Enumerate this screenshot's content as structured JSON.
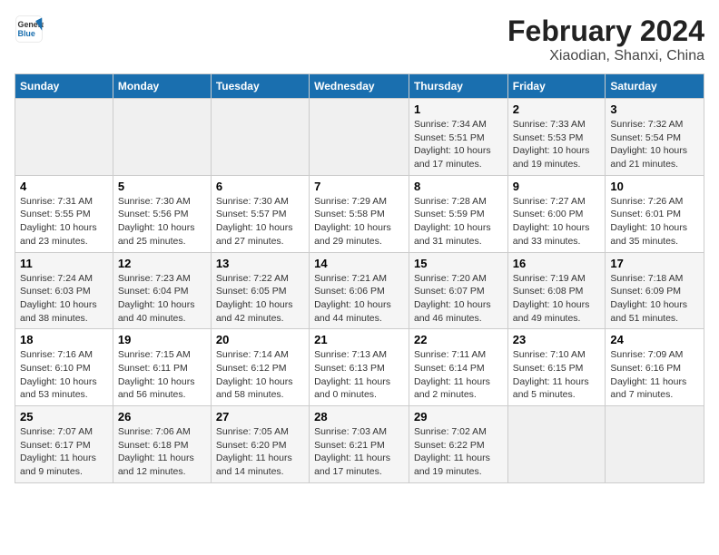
{
  "header": {
    "logo_line1": "General",
    "logo_line2": "Blue",
    "title": "February 2024",
    "subtitle": "Xiaodian, Shanxi, China"
  },
  "weekdays": [
    "Sunday",
    "Monday",
    "Tuesday",
    "Wednesday",
    "Thursday",
    "Friday",
    "Saturday"
  ],
  "weeks": [
    [
      {
        "day": "",
        "info": ""
      },
      {
        "day": "",
        "info": ""
      },
      {
        "day": "",
        "info": ""
      },
      {
        "day": "",
        "info": ""
      },
      {
        "day": "1",
        "info": "Sunrise: 7:34 AM\nSunset: 5:51 PM\nDaylight: 10 hours and 17 minutes."
      },
      {
        "day": "2",
        "info": "Sunrise: 7:33 AM\nSunset: 5:53 PM\nDaylight: 10 hours and 19 minutes."
      },
      {
        "day": "3",
        "info": "Sunrise: 7:32 AM\nSunset: 5:54 PM\nDaylight: 10 hours and 21 minutes."
      }
    ],
    [
      {
        "day": "4",
        "info": "Sunrise: 7:31 AM\nSunset: 5:55 PM\nDaylight: 10 hours and 23 minutes."
      },
      {
        "day": "5",
        "info": "Sunrise: 7:30 AM\nSunset: 5:56 PM\nDaylight: 10 hours and 25 minutes."
      },
      {
        "day": "6",
        "info": "Sunrise: 7:30 AM\nSunset: 5:57 PM\nDaylight: 10 hours and 27 minutes."
      },
      {
        "day": "7",
        "info": "Sunrise: 7:29 AM\nSunset: 5:58 PM\nDaylight: 10 hours and 29 minutes."
      },
      {
        "day": "8",
        "info": "Sunrise: 7:28 AM\nSunset: 5:59 PM\nDaylight: 10 hours and 31 minutes."
      },
      {
        "day": "9",
        "info": "Sunrise: 7:27 AM\nSunset: 6:00 PM\nDaylight: 10 hours and 33 minutes."
      },
      {
        "day": "10",
        "info": "Sunrise: 7:26 AM\nSunset: 6:01 PM\nDaylight: 10 hours and 35 minutes."
      }
    ],
    [
      {
        "day": "11",
        "info": "Sunrise: 7:24 AM\nSunset: 6:03 PM\nDaylight: 10 hours and 38 minutes."
      },
      {
        "day": "12",
        "info": "Sunrise: 7:23 AM\nSunset: 6:04 PM\nDaylight: 10 hours and 40 minutes."
      },
      {
        "day": "13",
        "info": "Sunrise: 7:22 AM\nSunset: 6:05 PM\nDaylight: 10 hours and 42 minutes."
      },
      {
        "day": "14",
        "info": "Sunrise: 7:21 AM\nSunset: 6:06 PM\nDaylight: 10 hours and 44 minutes."
      },
      {
        "day": "15",
        "info": "Sunrise: 7:20 AM\nSunset: 6:07 PM\nDaylight: 10 hours and 46 minutes."
      },
      {
        "day": "16",
        "info": "Sunrise: 7:19 AM\nSunset: 6:08 PM\nDaylight: 10 hours and 49 minutes."
      },
      {
        "day": "17",
        "info": "Sunrise: 7:18 AM\nSunset: 6:09 PM\nDaylight: 10 hours and 51 minutes."
      }
    ],
    [
      {
        "day": "18",
        "info": "Sunrise: 7:16 AM\nSunset: 6:10 PM\nDaylight: 10 hours and 53 minutes."
      },
      {
        "day": "19",
        "info": "Sunrise: 7:15 AM\nSunset: 6:11 PM\nDaylight: 10 hours and 56 minutes."
      },
      {
        "day": "20",
        "info": "Sunrise: 7:14 AM\nSunset: 6:12 PM\nDaylight: 10 hours and 58 minutes."
      },
      {
        "day": "21",
        "info": "Sunrise: 7:13 AM\nSunset: 6:13 PM\nDaylight: 11 hours and 0 minutes."
      },
      {
        "day": "22",
        "info": "Sunrise: 7:11 AM\nSunset: 6:14 PM\nDaylight: 11 hours and 2 minutes."
      },
      {
        "day": "23",
        "info": "Sunrise: 7:10 AM\nSunset: 6:15 PM\nDaylight: 11 hours and 5 minutes."
      },
      {
        "day": "24",
        "info": "Sunrise: 7:09 AM\nSunset: 6:16 PM\nDaylight: 11 hours and 7 minutes."
      }
    ],
    [
      {
        "day": "25",
        "info": "Sunrise: 7:07 AM\nSunset: 6:17 PM\nDaylight: 11 hours and 9 minutes."
      },
      {
        "day": "26",
        "info": "Sunrise: 7:06 AM\nSunset: 6:18 PM\nDaylight: 11 hours and 12 minutes."
      },
      {
        "day": "27",
        "info": "Sunrise: 7:05 AM\nSunset: 6:20 PM\nDaylight: 11 hours and 14 minutes."
      },
      {
        "day": "28",
        "info": "Sunrise: 7:03 AM\nSunset: 6:21 PM\nDaylight: 11 hours and 17 minutes."
      },
      {
        "day": "29",
        "info": "Sunrise: 7:02 AM\nSunset: 6:22 PM\nDaylight: 11 hours and 19 minutes."
      },
      {
        "day": "",
        "info": ""
      },
      {
        "day": "",
        "info": ""
      }
    ]
  ]
}
